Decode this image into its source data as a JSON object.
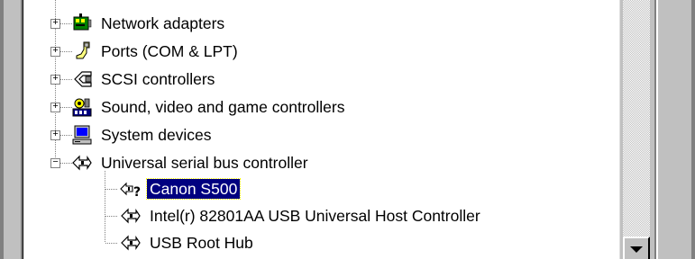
{
  "tree": {
    "items": [
      {
        "label": "Network adapters",
        "expander": "+",
        "icon": "network-adapter-icon"
      },
      {
        "label": "Ports (COM & LPT)",
        "expander": "+",
        "icon": "port-icon"
      },
      {
        "label": "SCSI controllers",
        "expander": "+",
        "icon": "scsi-icon"
      },
      {
        "label": "Sound, video and game controllers",
        "expander": "+",
        "icon": "sound-icon"
      },
      {
        "label": "System devices",
        "expander": "+",
        "icon": "computer-icon"
      },
      {
        "label": "Universal serial bus controller",
        "expander": "−",
        "icon": "usb-icon",
        "children": [
          {
            "label": "Canon S500",
            "icon": "usb-device-warning-icon",
            "selected": true
          },
          {
            "label": "Intel(r) 82801AA USB Universal Host Controller",
            "icon": "usb-icon"
          },
          {
            "label": "USB Root Hub",
            "icon": "usb-icon"
          }
        ]
      }
    ]
  },
  "colors": {
    "selection": "#000080",
    "window_face": "#c0c0c0"
  }
}
